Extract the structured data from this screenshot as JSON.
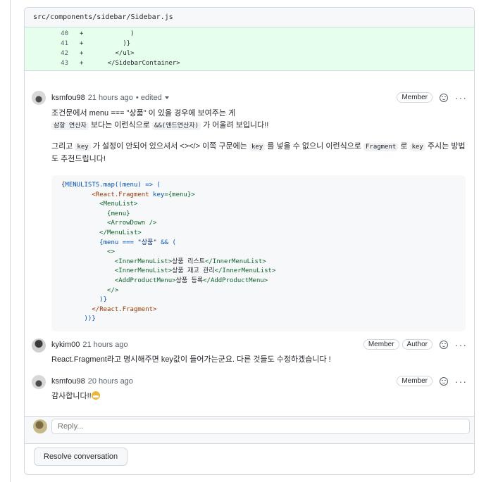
{
  "file": {
    "path": "src/components/sidebar/Sidebar.js"
  },
  "diff_lines": [
    {
      "num": "40",
      "sign": "+",
      "text": "          )"
    },
    {
      "num": "41",
      "sign": "+",
      "text": "        )}"
    },
    {
      "num": "42",
      "sign": "+",
      "text": "      </ul>"
    },
    {
      "num": "43",
      "sign": "+",
      "text": "    </SidebarContainer>"
    }
  ],
  "comment1": {
    "author": "ksmfou98",
    "time": "21 hours ago",
    "edited": "• edited",
    "badge": "Member",
    "p1_a": "조건문에서 menu === \"상품\" 이 있을 경우에 보여주는 게",
    "p1_code1": "삼항 연산자",
    "p1_b": " 보다는 이런식으로 ",
    "p1_code2": "&&(앤드연산자)",
    "p1_c": " 가 어울려 보입니다!!",
    "p2_a": "그리고 ",
    "p2_code1": "key",
    "p2_b": " 가 설정이 안되어 있으셔서 <></> 이쪽 구문에는 ",
    "p2_code2": "key",
    "p2_c": " 를 넣을 수 없으니 이런식으로 ",
    "p2_code3": "Fragment",
    "p2_d": " 로 ",
    "p2_code4": "key",
    "p2_e": " 주시는 방법도 추천드립니다!",
    "code": {
      "l1a": "{",
      "l1b": "MENULISTS",
      "l1c": ".map((menu) => (",
      "l2a": "        <",
      "l2b": "React.Fragment",
      "l2c": " key",
      "l2d": "={menu}>",
      "l3": "          <MenuList>",
      "l4": "            {menu}",
      "l5": "            <ArrowDown />",
      "l6": "          </MenuList>",
      "l7a": "          {menu === ",
      "l7b": "\"상품\"",
      "l7c": " && (",
      "l8": "            <>",
      "l9a": "              <InnerMenuList>",
      "l9b": "상품 리스트",
      "l9c": "</InnerMenuList>",
      "l10a": "              <InnerMenuList>",
      "l10b": "상품 재고 관리",
      "l10c": "</InnerMenuList>",
      "l11a": "              <AddProductMenu>",
      "l11b": "상품 등록",
      "l11c": "</AddProductMenu>",
      "l12": "            </>",
      "l13": "          )}",
      "l14a": "        </",
      "l14b": "React.Fragment",
      "l14c": ">",
      "l15": "      ))}"
    }
  },
  "comment2": {
    "author": "kykim00",
    "time": "21 hours ago",
    "badge1": "Member",
    "badge2": "Author",
    "body": "React.Fragment라고 명시해주면 key값이 들어가는군요. 다른 것들도 수정하겠습니다 !"
  },
  "comment3": {
    "author": "ksmfou98",
    "time": "20 hours ago",
    "badge": "Member",
    "body": "감사합니다!!"
  },
  "reply": {
    "placeholder": "Reply..."
  },
  "resolve": {
    "label": "Resolve conversation"
  }
}
